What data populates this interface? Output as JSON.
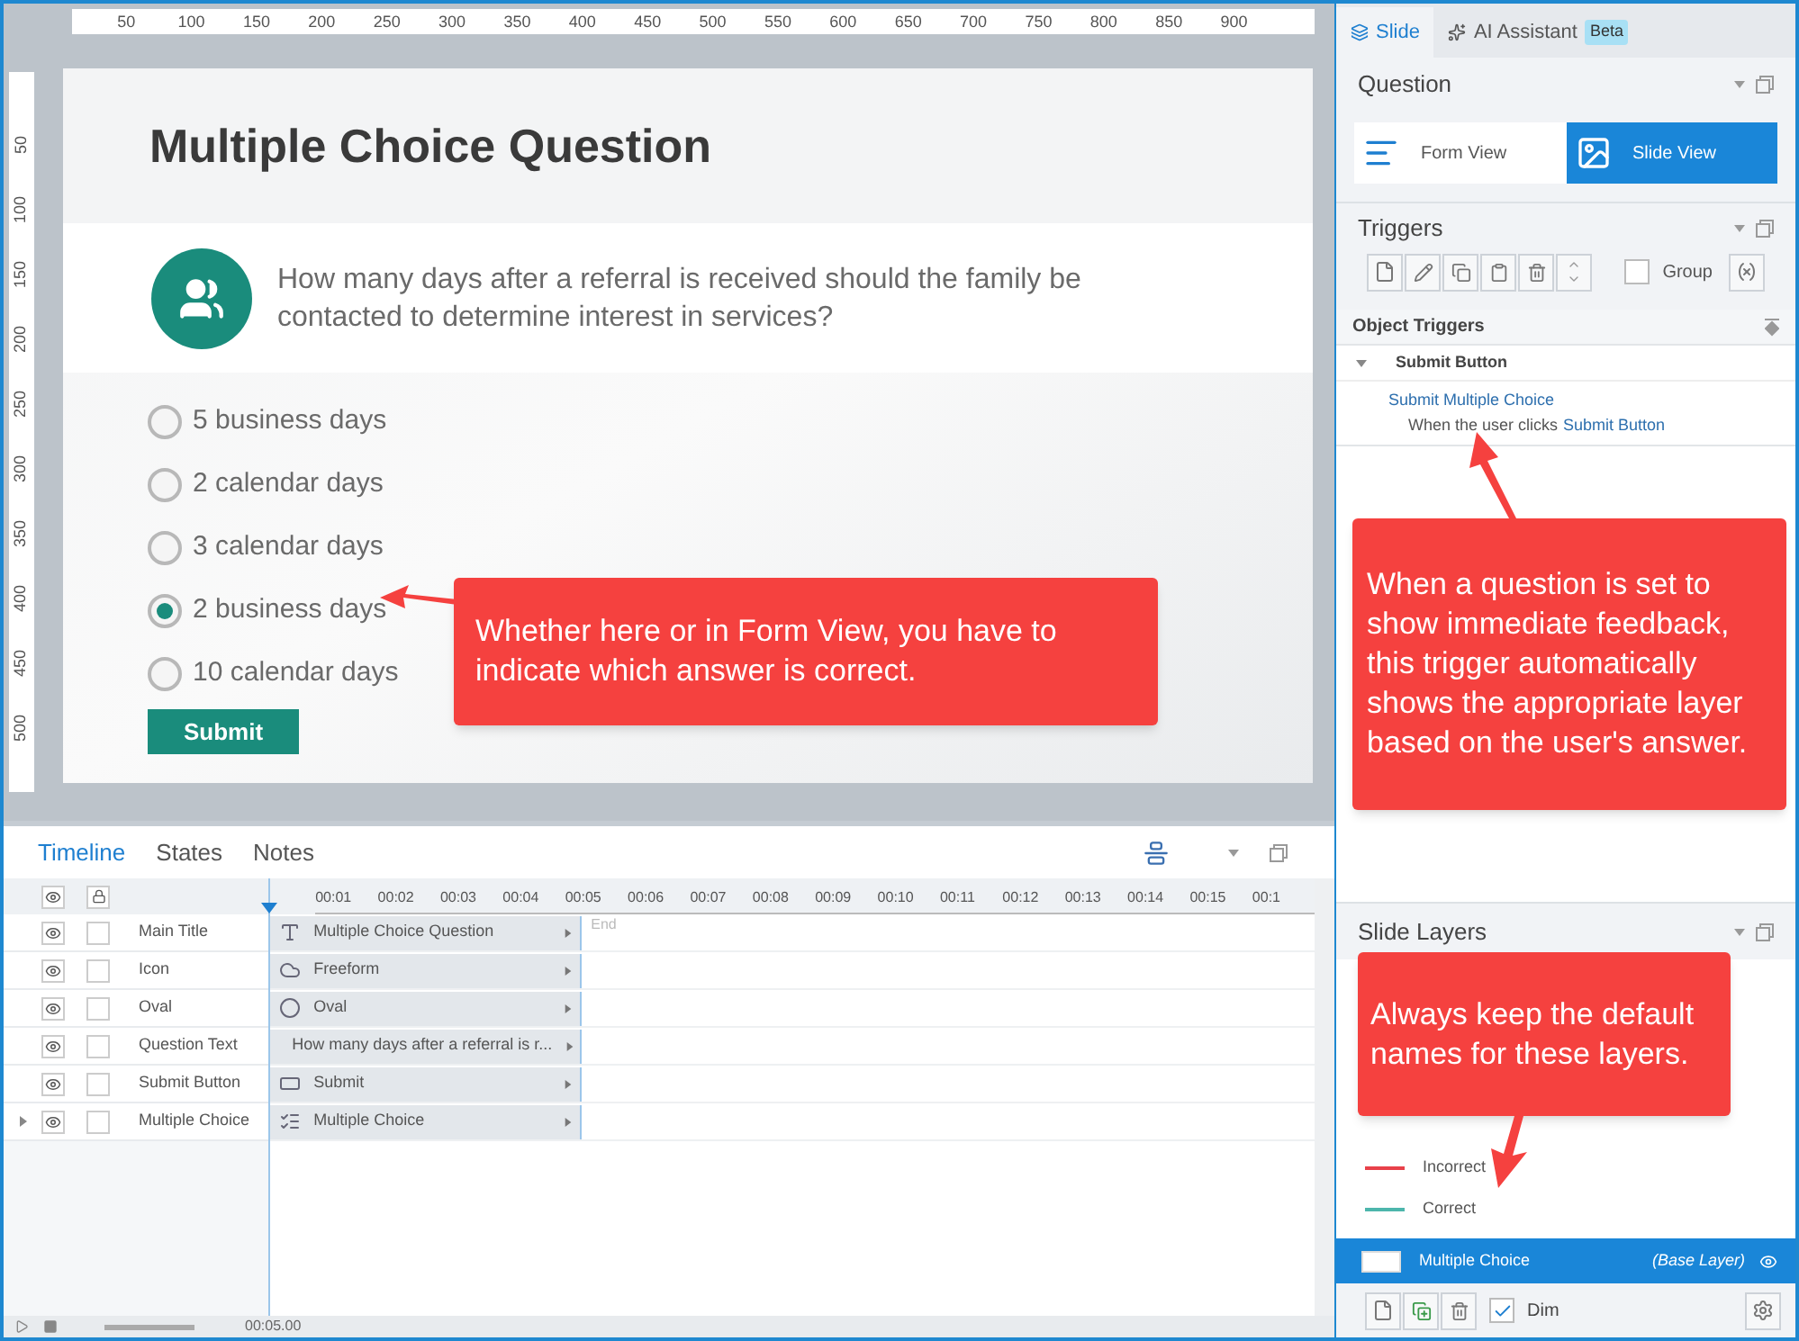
{
  "ruler": {
    "h_labels": [
      "50",
      "100",
      "150",
      "200",
      "250",
      "300",
      "350",
      "400",
      "450",
      "500",
      "550",
      "600",
      "650",
      "700",
      "750",
      "800",
      "850",
      "900"
    ],
    "v_labels": [
      "50",
      "100",
      "150",
      "200",
      "250",
      "300",
      "350",
      "400",
      "450",
      "500"
    ]
  },
  "slide": {
    "title": "Multiple Choice Question",
    "question": "How many days after a referral is received should the family be contacted to determine interest in services?",
    "choices": [
      {
        "label": "5 business days",
        "selected": false
      },
      {
        "label": "2 calendar days",
        "selected": false
      },
      {
        "label": "3 calendar days",
        "selected": false
      },
      {
        "label": "2 business days",
        "selected": true
      },
      {
        "label": "10 calendar days",
        "selected": false
      }
    ],
    "submit": "Submit"
  },
  "timeline": {
    "tabs": [
      {
        "label": "Timeline",
        "selected": true
      },
      {
        "label": "States",
        "selected": false
      },
      {
        "label": "Notes",
        "selected": false
      }
    ],
    "ticks": [
      "00:01",
      "00:02",
      "00:03",
      "00:04",
      "00:05",
      "00:06",
      "00:07",
      "00:08",
      "00:09",
      "00:10",
      "00:11",
      "00:12",
      "00:13",
      "00:14",
      "00:15",
      "00:1"
    ],
    "end_label": "End",
    "rows": [
      {
        "name": "Main Title",
        "bar": "Multiple Choice Question",
        "kind": "text",
        "expandable": false,
        "locked": false
      },
      {
        "name": "Icon",
        "bar": "Freeform",
        "kind": "freeform",
        "expandable": false,
        "locked": false
      },
      {
        "name": "Oval",
        "bar": "Oval",
        "kind": "oval",
        "expandable": false,
        "locked": false
      },
      {
        "name": "Question Text",
        "bar": "How many days after a referral is r...",
        "kind": "textbox",
        "expandable": false,
        "locked": false
      },
      {
        "name": "Submit Button",
        "bar": "Submit",
        "kind": "button",
        "expandable": false,
        "locked": false
      },
      {
        "name": "Multiple Choice",
        "bar": "Multiple Choice",
        "kind": "choice",
        "expandable": true,
        "locked": false
      }
    ],
    "time": "00:05.00"
  },
  "panel": {
    "tabs": [
      {
        "label": "Slide",
        "selected": true
      },
      {
        "label": "AI Assistant",
        "badge": "Beta",
        "selected": false
      }
    ],
    "question_title": "Question",
    "views": [
      {
        "label": "Form View",
        "selected": false
      },
      {
        "label": "Slide View",
        "selected": true
      }
    ],
    "triggers_title": "Triggers",
    "group": {
      "label": "Group",
      "checked": false
    },
    "object_triggers_title": "Object Triggers",
    "trigger_object": "Submit Button",
    "trigger_action": "Submit Multiple Choice",
    "trigger_condition": "When the user clicks",
    "trigger_condition_object": "Submit Button",
    "layers_title": "Slide Layers",
    "layers": [
      {
        "name": "Incorrect",
        "color": "#e8414a"
      },
      {
        "name": "Correct",
        "color": "#4db6ac"
      }
    ],
    "base_layer": {
      "name": "Multiple Choice",
      "note": "(Base Layer)",
      "selected": true
    },
    "dim": {
      "label": "Dim",
      "checked": true
    }
  },
  "callouts": [
    "Whether here or in Form View, you have to indicate which answer is correct.",
    "When a question is set to show immediate feedback, this trigger automatically shows the appropriate layer based on the user's answer.",
    "Always keep the default names for these layers."
  ]
}
